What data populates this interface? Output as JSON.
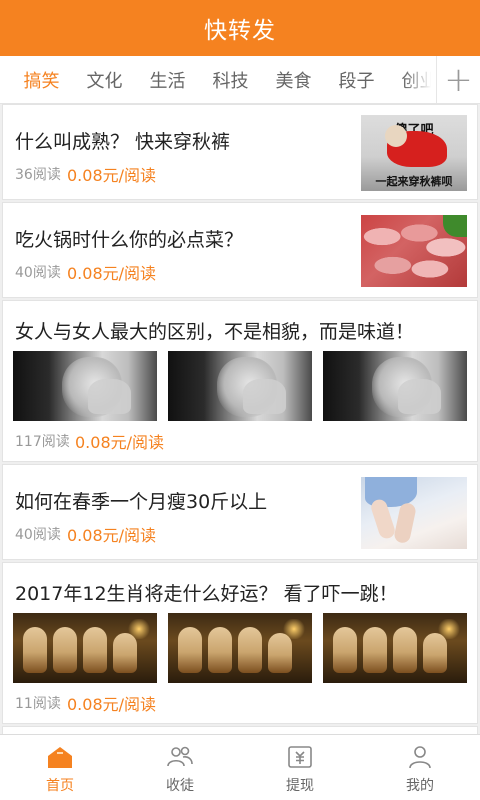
{
  "header": {
    "title": "快转发"
  },
  "tabs": {
    "items": [
      "搞笑",
      "文化",
      "生活",
      "科技",
      "美食",
      "段子",
      "创业"
    ],
    "active": "搞笑",
    "add_icon": "plus-icon"
  },
  "feed": [
    {
      "title": "什么叫成熟？ 快来穿秋裤",
      "reads": "36阅读",
      "price": "0.08元/阅读",
      "image_caption_top": "傻了吧",
      "image_caption_bottom": "一起来穿秋裤呗"
    },
    {
      "title": "吃火锅时什么你的必点菜？",
      "reads": "40阅读",
      "price": "0.08元/阅读"
    },
    {
      "title": "女人与女人最大的区别，不是相貌，而是味道！",
      "reads": "117阅读",
      "price": "0.08元/阅读"
    },
    {
      "title": "如何在春季一个月瘦30斤以上",
      "reads": "40阅读",
      "price": "0.08元/阅读"
    },
    {
      "title": "2017年12生肖将走什么好运？ 看了吓一跳！",
      "reads": "11阅读",
      "price": "0.08元/阅读"
    }
  ],
  "bottom_nav": {
    "items": [
      {
        "label": "首页",
        "icon": "home-icon",
        "active": true
      },
      {
        "label": "收徒",
        "icon": "users-icon",
        "active": false
      },
      {
        "label": "提现",
        "icon": "wallet-icon",
        "active": false
      },
      {
        "label": "我的",
        "icon": "user-icon",
        "active": false
      }
    ]
  },
  "colors": {
    "accent": "#f58220",
    "header_bg": "#f58220",
    "muted_text": "#999999",
    "background": "#efefef"
  }
}
